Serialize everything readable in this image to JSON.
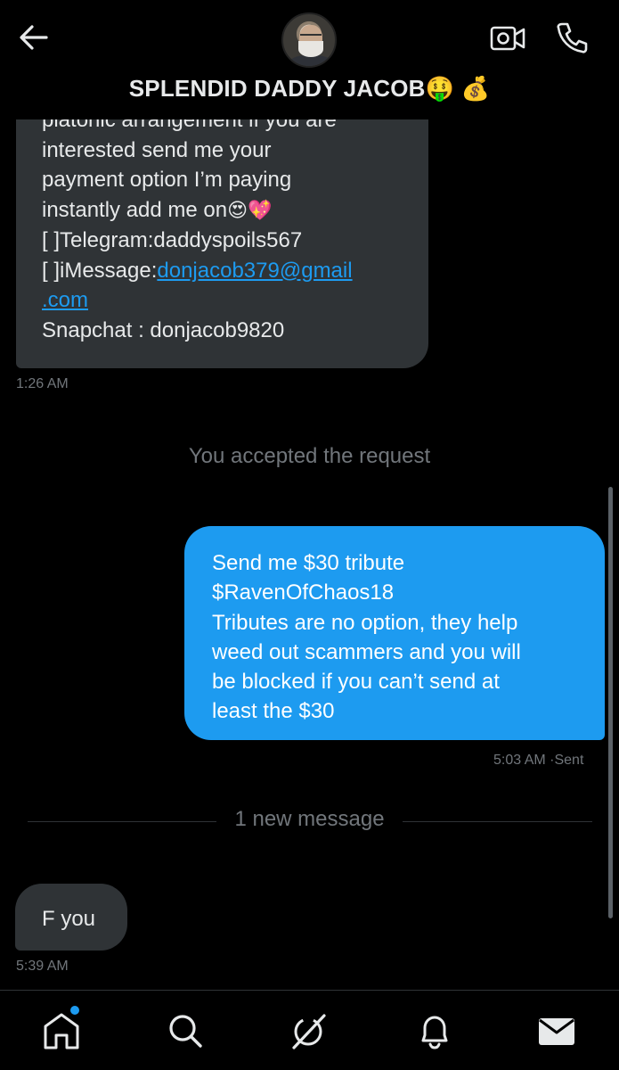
{
  "header": {
    "title": "SPLENDID DADDY JACOB🤑 💰"
  },
  "messages": {
    "first": {
      "lines": [
        "platonic arrangement if you are",
        "interested send me your",
        "payment option I’m paying",
        "instantly add me on"
      ],
      "emojis": "😍💖",
      "telegram": "[ ]Telegram:daddyspoils567",
      "imessage_prefix": "[ ]iMessage:",
      "imessage_link_part1": "donjacob379@gmail",
      "imessage_link_part2": ".com",
      "snapchat": "Snapchat : donjacob9820",
      "time": "1:26 AM"
    },
    "system_note": "You accepted the request",
    "sent": {
      "lines": [
        "Send me $30 tribute",
        "$RavenOfChaos18",
        "Tributes are no option, they help",
        "weed out scammers and you will",
        "be blocked if you can’t send at",
        "least the $30"
      ],
      "time": "5:03 AM",
      "status": "·Sent"
    },
    "new_divider": "1 new message",
    "reply": {
      "text": "F you",
      "time": "5:39 AM"
    }
  },
  "colors": {
    "accent": "#1d9bf0",
    "incoming_bubble": "#2f3336",
    "muted_text": "#71767b",
    "background": "#000000"
  },
  "icons": {
    "back": "arrow-left-icon",
    "video": "video-camera-icon",
    "call": "phone-icon",
    "home": "home-icon",
    "search": "search-icon",
    "grok": "grok-icon",
    "notifications": "bell-icon",
    "messages": "envelope-icon"
  }
}
